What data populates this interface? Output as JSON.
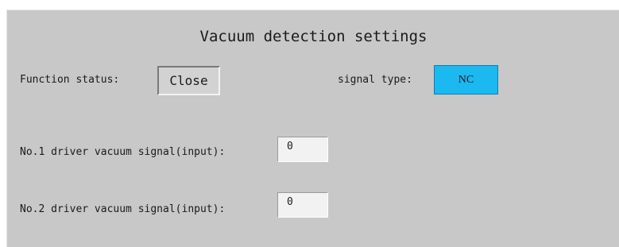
{
  "title": "Vacuum detection settings",
  "function_status": {
    "label": "Function status:",
    "value": "Close"
  },
  "signal_type": {
    "label": "signal type:",
    "value": "NC",
    "color": "#1cb8f0"
  },
  "inputs": [
    {
      "label": "No.1 driver vacuum signal(input):",
      "value": "0"
    },
    {
      "label": "No.2 driver vacuum signal(input):",
      "value": "0"
    }
  ]
}
